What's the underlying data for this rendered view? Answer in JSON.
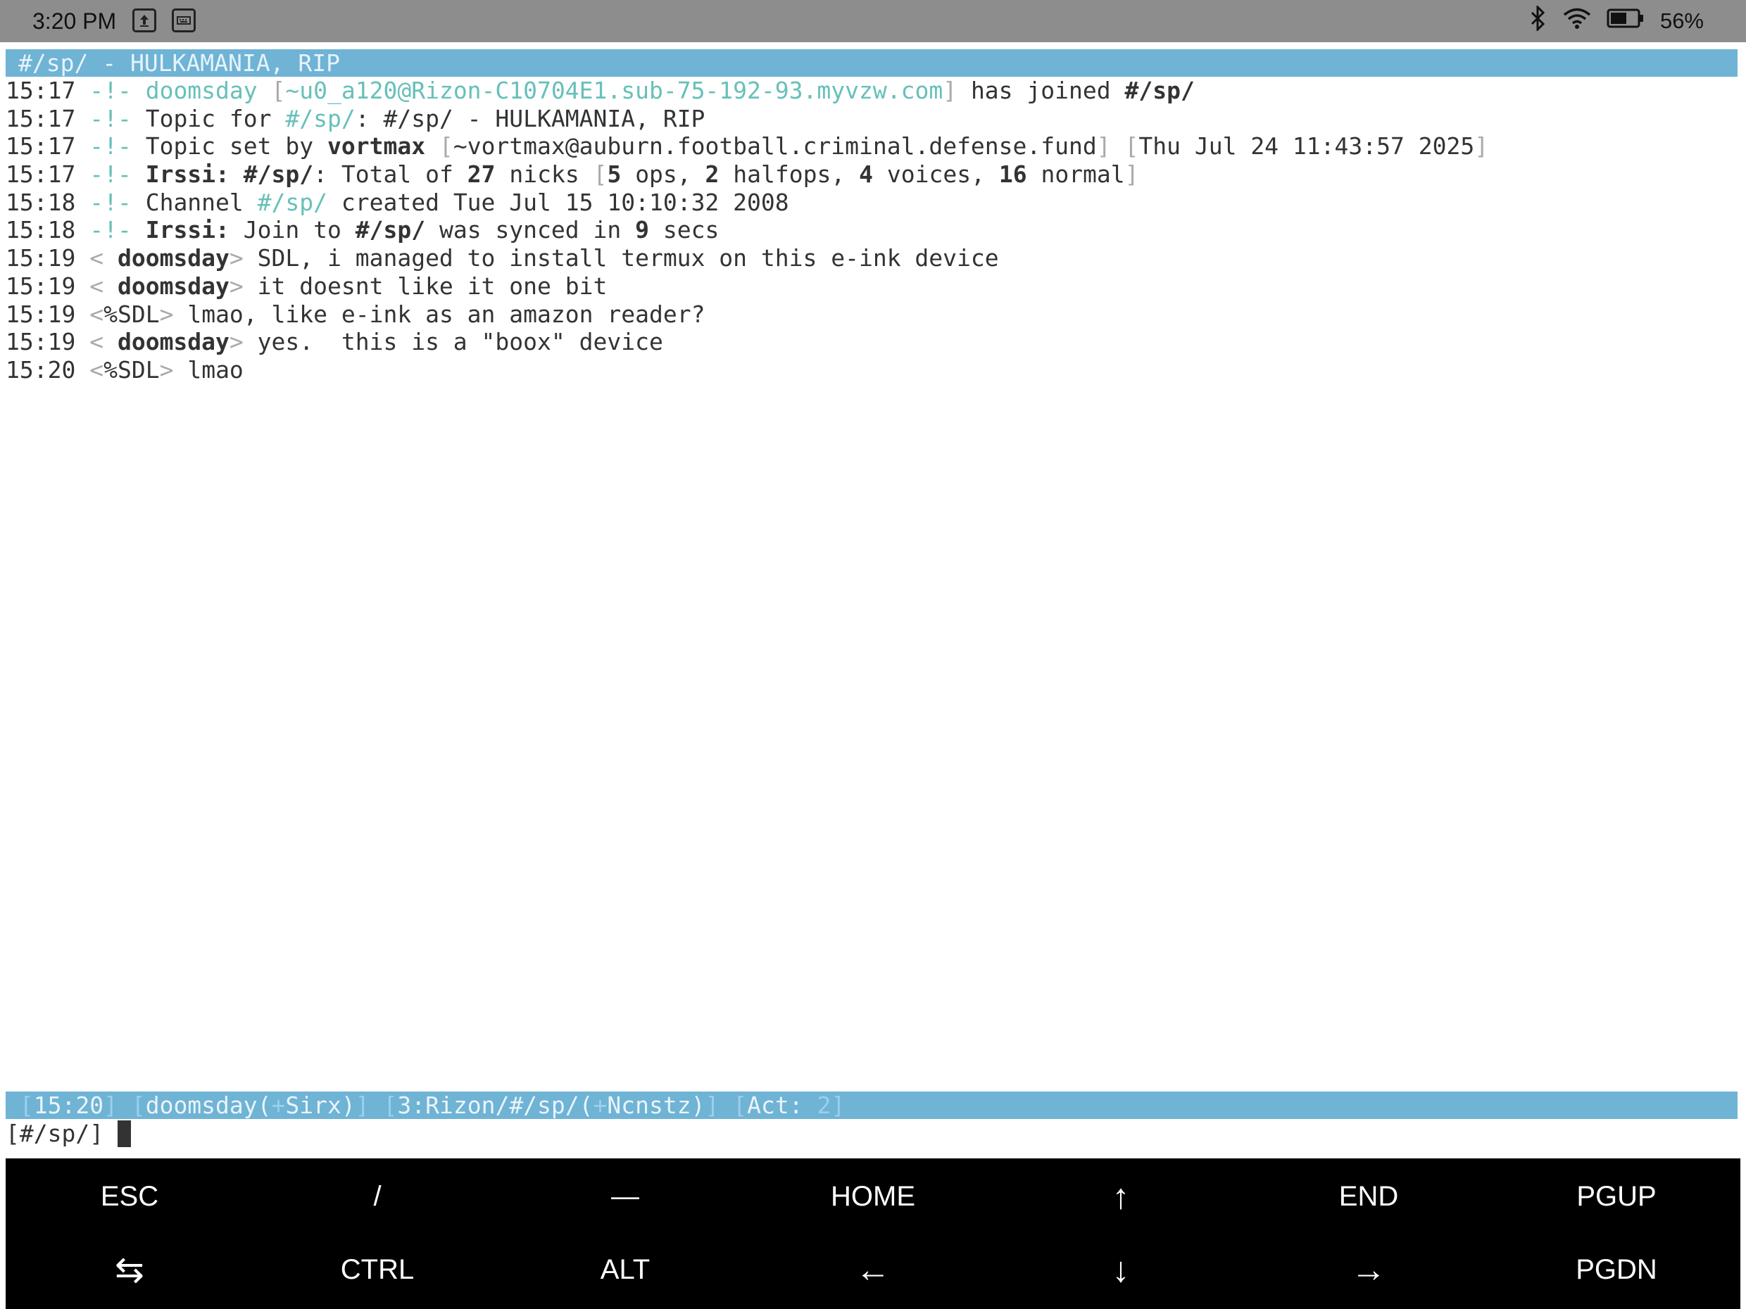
{
  "status_bar": {
    "time": "3:20 PM",
    "battery": "56%",
    "icons": [
      "upload-icon",
      "keyboard-icon",
      "bluetooth-icon",
      "wifi-icon",
      "battery-icon"
    ]
  },
  "irc": {
    "topic_bar": "#/sp/ - HULKAMANIA, RIP",
    "lines": {
      "l1": {
        "time": "15:17",
        "marker": "-!-",
        "nick": "doomsday",
        "host": "~u0_a120@Rizon-C10704E1.sub-75-192-93.myvzw.com",
        "text": "has joined",
        "chan": "#/sp/"
      },
      "l2": {
        "time": "15:17",
        "marker": "-!-",
        "pre": "Topic for",
        "chan": "#/sp/",
        "text": ": #/sp/ - HULKAMANIA, RIP"
      },
      "l3": {
        "time": "15:17",
        "marker": "-!-",
        "pre": "Topic set by",
        "nick": "vortmax",
        "host": "~vortmax@auburn.football.criminal.defense.fund",
        "date": "Thu Jul 24 11:43:57 2025"
      },
      "l4": {
        "time": "15:17",
        "marker": "-!-",
        "prefix": "Irssi:",
        "chan": "#/sp/",
        "pre": "Total of",
        "total": "27",
        "mid": "nicks",
        "ops": "5",
        "ops_label": "ops,",
        "halfops": "2",
        "halfops_label": "halfops,",
        "voices": "4",
        "voices_label": "voices,",
        "normal": "16",
        "normal_label": "normal"
      },
      "l5": {
        "time": "15:18",
        "marker": "-!-",
        "pre": "Channel",
        "chan": "#/sp/",
        "text": "created Tue Jul 15 10:10:32 2008"
      },
      "l6": {
        "time": "15:18",
        "marker": "-!-",
        "prefix": "Irssi:",
        "pre": "Join to",
        "chan": "#/sp/",
        "text": "was synced in",
        "secs": "9",
        "secs_label": "secs"
      }
    },
    "messages": [
      {
        "time": "15:19",
        "nick": " doomsday",
        "text": "SDL, i managed to install termux on this e-ink device",
        "bold": true
      },
      {
        "time": "15:19",
        "nick": " doomsday",
        "text": "it doesnt like it one bit",
        "bold": true
      },
      {
        "time": "15:19",
        "nick": "%SDL",
        "text": "lmao, like e-ink as an amazon reader?",
        "bold": false
      },
      {
        "time": "15:19",
        "nick": " doomsday",
        "text": "yes.  this is a \"boox\" device",
        "bold": true
      },
      {
        "time": "15:20",
        "nick": "%SDL",
        "text": "lmao",
        "bold": false
      }
    ],
    "status_line": {
      "time": "15:20",
      "nick": "doomsday",
      "nick_mode": "+",
      "umode": "Sirx",
      "window": "3:Rizon/#/sp/",
      "chan_mode": "+",
      "cmode": "Ncnstz",
      "act_label": "Act:",
      "act": "2"
    },
    "prompt": "[#/sp/] "
  },
  "extra_keys": {
    "row1": [
      "ESC",
      "/",
      "—",
      "HOME",
      "↑",
      "END",
      "PGUP"
    ],
    "row2": [
      "⇆",
      "CTRL",
      "ALT",
      "←",
      "↓",
      "→",
      "PGDN"
    ]
  }
}
